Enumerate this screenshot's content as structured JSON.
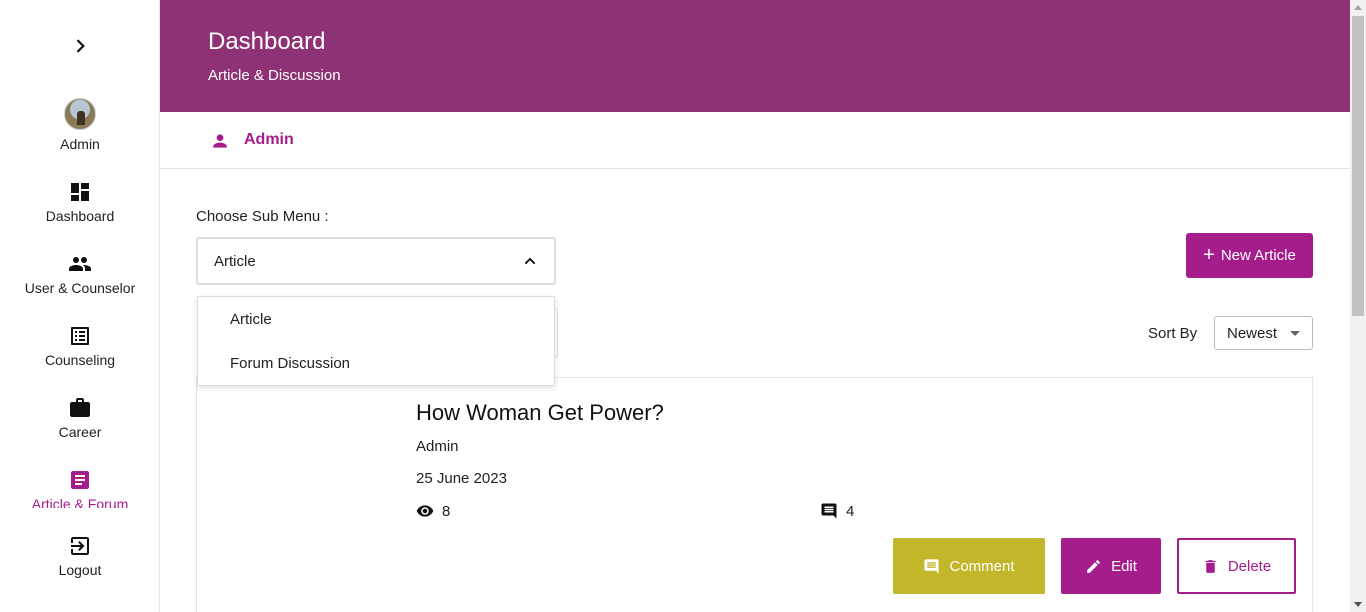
{
  "sidebar": {
    "toggle_icon": "chevron-right-icon",
    "user_label": "Admin",
    "items": [
      {
        "label": "Dashboard",
        "icon": "dashboard-icon"
      },
      {
        "label": "User & Counselor",
        "icon": "people-icon"
      },
      {
        "label": "Counseling",
        "icon": "list-icon"
      },
      {
        "label": "Career",
        "icon": "briefcase-icon"
      },
      {
        "label": "Article & Forum",
        "icon": "article-icon",
        "active": true
      },
      {
        "label": "Logout",
        "icon": "logout-icon"
      }
    ]
  },
  "header": {
    "title": "Dashboard",
    "subtitle": "Article & Discussion",
    "background": "#8e3175"
  },
  "userbar": {
    "name": "Admin",
    "icon": "person-icon"
  },
  "submenu": {
    "label": "Choose Sub Menu :",
    "selected": "Article",
    "options": [
      "Article",
      "Forum Discussion"
    ]
  },
  "new_button": {
    "label": "New Article",
    "icon": "plus-icon"
  },
  "sort": {
    "label": "Sort By",
    "selected": "Newest"
  },
  "article": {
    "title": "How Woman Get Power?",
    "author": "Admin",
    "date": "25 June 2023",
    "views": "8",
    "comments": "4"
  },
  "actions": {
    "comment": "Comment",
    "edit": "Edit",
    "delete": "Delete"
  },
  "colors": {
    "accent": "#a51d8b",
    "comment_button": "#c2b62b",
    "header": "#8e3175"
  }
}
